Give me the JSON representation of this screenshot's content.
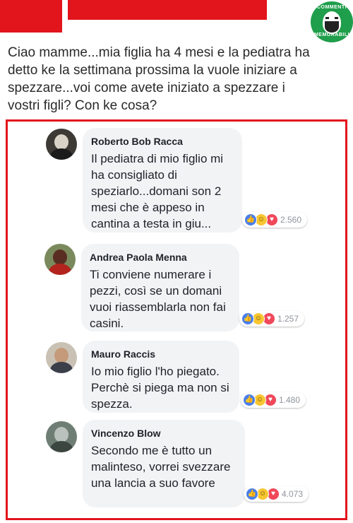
{
  "post": {
    "text": "Ciao mamme...mia figlia ha 4 mesi e la pediatra ha detto ke la settimana prossima la vuole iniziare a spezzare...voi come avete iniziato a spezzare i vostri figli? Con ke cosa?"
  },
  "logo": {
    "top_text": "COMMENTI",
    "bottom_text": "MEMORABILI"
  },
  "colors": {
    "accent": "#e2141c",
    "logo_green": "#1f9e4b",
    "bubble": "#f2f3f5",
    "like": "#4a7fe8",
    "haha": "#f7c631",
    "love": "#f0485a"
  },
  "comments": [
    {
      "author": "Roberto Bob Racca",
      "text": "Il pediatra di mio figlio mi ha consigliato di speziarlo...domani son 2 mesi che è appeso in cantina a testa in giu...",
      "reaction_count": "2.560",
      "reaction_icons": [
        "like-icon",
        "haha-icon",
        "love-icon"
      ]
    },
    {
      "author": "Andrea Paola Menna",
      "text": "Ti conviene numerare i pezzi, così se un domani vuoi riassemblarla non fai casini.",
      "reaction_count": "1.257",
      "reaction_icons": [
        "like-icon",
        "haha-icon",
        "love-icon"
      ]
    },
    {
      "author": "Mauro Raccis",
      "text": "Io mio figlio l'ho piegato. Perchè si piega ma non si spezza.",
      "reaction_count": "1.480",
      "reaction_icons": [
        "like-icon",
        "haha-icon",
        "love-icon"
      ]
    },
    {
      "author": "Vincenzo Blow",
      "text": "Secondo me è tutto un malinteso, vorrei svezzare una lancia a suo favore",
      "reaction_count": "4.073",
      "reaction_icons": [
        "like-icon",
        "haha-icon",
        "love-icon"
      ]
    }
  ]
}
